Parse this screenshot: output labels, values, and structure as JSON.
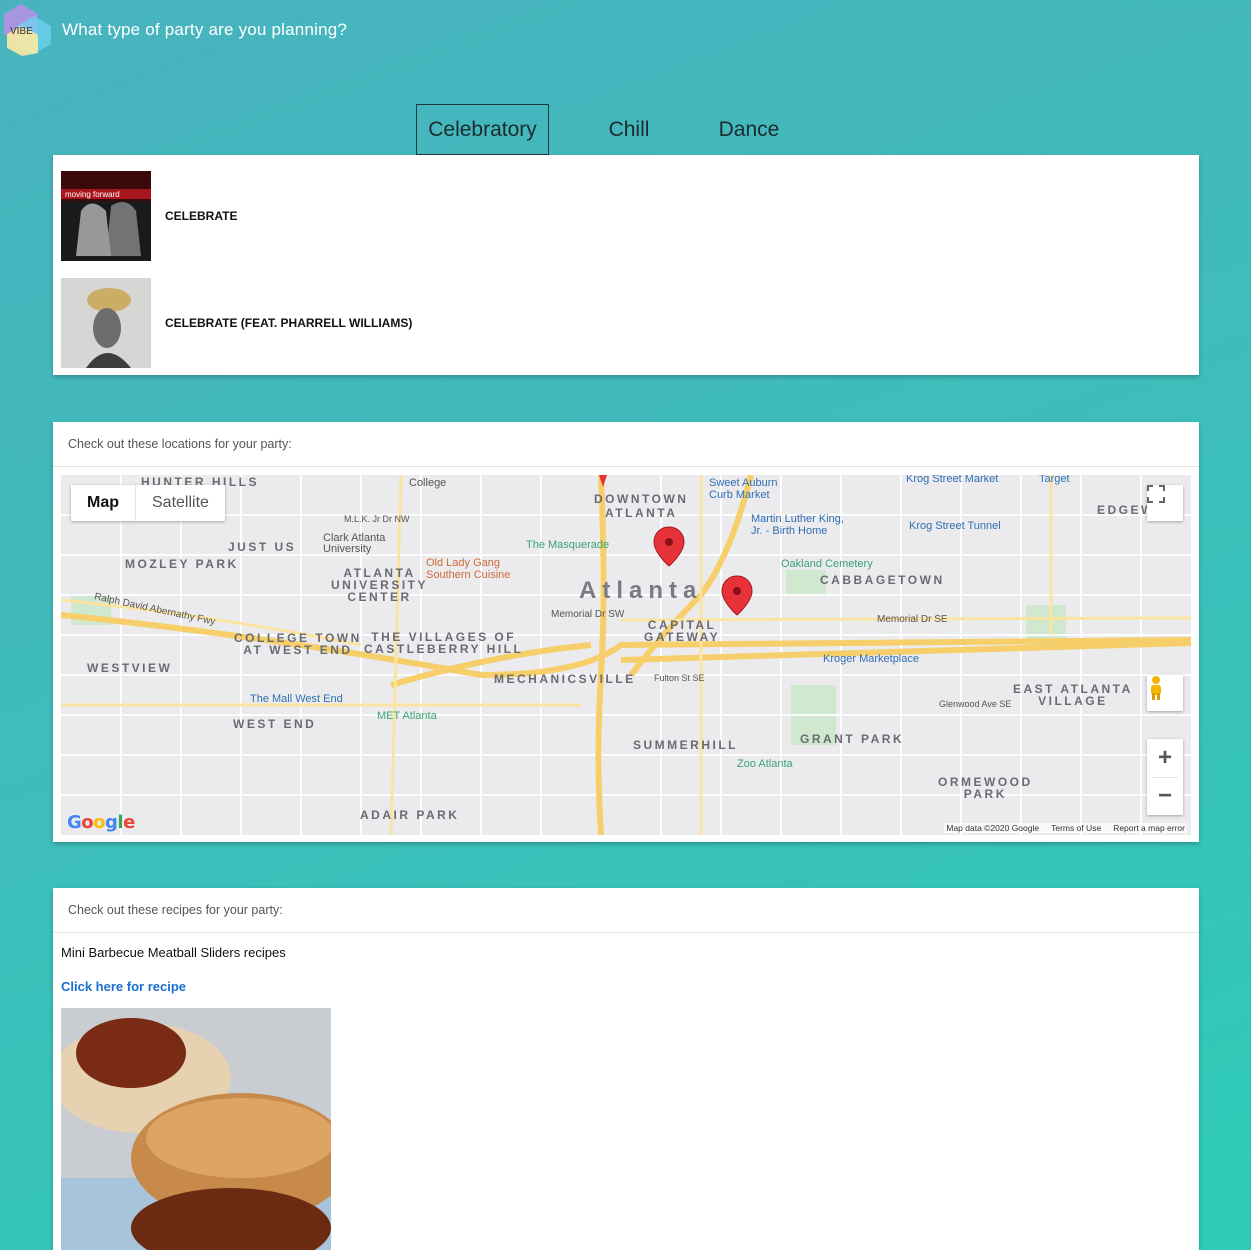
{
  "header": {
    "logo_text": "VIBE",
    "question": "What type of party are you planning?"
  },
  "tabs": [
    {
      "label": "Celebratory",
      "active": true
    },
    {
      "label": "Chill",
      "active": false
    },
    {
      "label": "Dance",
      "active": false
    }
  ],
  "songs": [
    {
      "title": "CELEBRATE",
      "art_text": "moving forward"
    },
    {
      "title": "CELEBRATE (FEAT. PHARRELL WILLIAMS)",
      "art_text": ""
    }
  ],
  "locations": {
    "heading": "Check out these locations for your party:",
    "map_type": {
      "map": "Map",
      "satellite": "Satellite"
    },
    "attribution": {
      "data": "Map data ©2020 Google",
      "terms": "Terms of Use",
      "report": "Report a map error"
    },
    "google": "Google",
    "labels": {
      "downtown": "DOWNTOWN\nATLANTA",
      "atlanta": "Atlanta",
      "mozley": "MOZLEY PARK",
      "justus": "JUST US",
      "auc": "ATLANTA\nUNIVERSITY\nCENTER",
      "cabbagetown": "CABBAGETOWN",
      "capital": "CAPITAL\nGATEWAY",
      "collegetown": "COLLEGE TOWN\nAT WEST END",
      "villages": "THE VILLAGES OF\nCASTLEBERRY HILL",
      "westview": "WESTVIEW",
      "mechanicsville": "MECHANICSVILLE",
      "eastatlanta": "EAST ATLANTA\nVILLAGE",
      "westend": "WEST END",
      "summerhill": "SUMMERHILL",
      "grantpark": "GRANT PARK",
      "ormewood": "ORMEWOOD\nPARK",
      "adairpark": "ADAIR PARK",
      "edgew": "EDGEW",
      "hunterhills": "HUNTER HILLS",
      "masquerade": "The Masquerade",
      "oldlady": "Old Lady Gang\nSouthern Cuisine",
      "clark": "Clark Atlanta\nUniversity",
      "oakland": "Oakland Cemetery",
      "mlk": "Martin Luther King,\nJr. - Birth Home",
      "sweetauburn": "Sweet Auburn\nCurb Market",
      "krogmarket": "Krog Street Market",
      "krogtunnel": "Krog Street Tunnel",
      "target": "Target",
      "kroger": "Kroger Marketplace",
      "mallwestend": "The Mall West End",
      "metatlanta": "MET Atlanta",
      "zoo": "Zoo Atlanta",
      "college": "College",
      "memorial1": "Memorial Dr SW",
      "memorial2": "Memorial Dr SE",
      "ralph": "Ralph David Abernathy Fwy",
      "fulton": "Fulton St SE",
      "glenwood": "Glenwood Ave SE",
      "mlkdr": "M.L.K. Jr Dr NW"
    }
  },
  "recipes": {
    "heading": "Check out these recipes for your party:",
    "name": "Mini Barbecue Meatball Sliders recipes",
    "link": "Click here for recipe"
  },
  "colors": {
    "accent_link": "#1a6fd1",
    "pin": "#e8323a"
  }
}
